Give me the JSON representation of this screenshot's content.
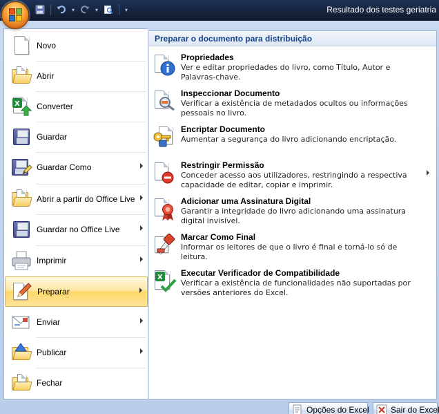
{
  "window": {
    "title": "Resultado dos testes geriatria"
  },
  "quick_access": {
    "icons": [
      "save-icon",
      "undo-icon",
      "redo-icon",
      "print-preview-icon",
      "customize-icon"
    ]
  },
  "menu": {
    "items": [
      {
        "label": "Novo",
        "icon": "new-document-icon",
        "has_submenu": false
      },
      {
        "label": "Abrir",
        "icon": "open-folder-icon",
        "has_submenu": false
      },
      {
        "label": "Converter",
        "icon": "convert-icon",
        "has_submenu": false
      },
      {
        "label": "Guardar",
        "icon": "save-icon",
        "has_submenu": false
      },
      {
        "label": "Guardar Como",
        "icon": "save-as-icon",
        "has_submenu": true
      },
      {
        "label": "Abrir a partir do Office Live",
        "icon": "office-live-open-icon",
        "has_submenu": true
      },
      {
        "label": "Guardar no Office Live",
        "icon": "office-live-save-icon",
        "has_submenu": true
      },
      {
        "label": "Imprimir",
        "icon": "printer-icon",
        "has_submenu": true
      },
      {
        "label": "Preparar",
        "icon": "prepare-icon",
        "has_submenu": true,
        "active": true
      },
      {
        "label": "Enviar",
        "icon": "send-icon",
        "has_submenu": true
      },
      {
        "label": "Publicar",
        "icon": "publish-icon",
        "has_submenu": true
      },
      {
        "label": "Fechar",
        "icon": "close-folder-icon",
        "has_submenu": false
      }
    ]
  },
  "panel": {
    "header": "Preparar o documento para distribuição",
    "items": [
      {
        "title": "Propriedades",
        "description": "Ver e editar propriedades do livro, como Título, Autor e Palavras-chave.",
        "icon": "properties-icon"
      },
      {
        "title": "Inspeccionar Documento",
        "description": "Verificar a existência de metadados ocultos ou informações pessoais no livro.",
        "icon": "inspect-document-icon"
      },
      {
        "title": "Encriptar Documento",
        "description": "Aumentar a segurança do livro adicionando encriptação.",
        "icon": "encrypt-key-icon"
      },
      {
        "title": "Restringir Permissão",
        "description": "Conceder acesso aos utilizadores, restringindo a respectiva capacidade de editar, copiar e imprimir.",
        "icon": "restrict-permission-icon",
        "has_submenu": true
      },
      {
        "title": "Adicionar uma Assinatura Digital",
        "description": "Garantir a integridade do livro adicionando uma assinatura digital invisível.",
        "icon": "digital-signature-icon"
      },
      {
        "title": "Marcar Como Final",
        "description": "Informar os leitores de que o livro é final e torná-lo só de leitura.",
        "icon": "mark-final-icon"
      },
      {
        "title": "Executar Verificador de Compatibilidade",
        "description": "Verificar a existência de funcionalidades não suportadas por versões anteriores do Excel.",
        "icon": "compatibility-checker-icon"
      }
    ]
  },
  "footer": {
    "options_label": "Opções do Excel",
    "exit_label": "Sair do Excel"
  },
  "colors": {
    "accent": "#15428b",
    "active_highlight": "#ffd869",
    "frame": "#c9d9ef"
  }
}
